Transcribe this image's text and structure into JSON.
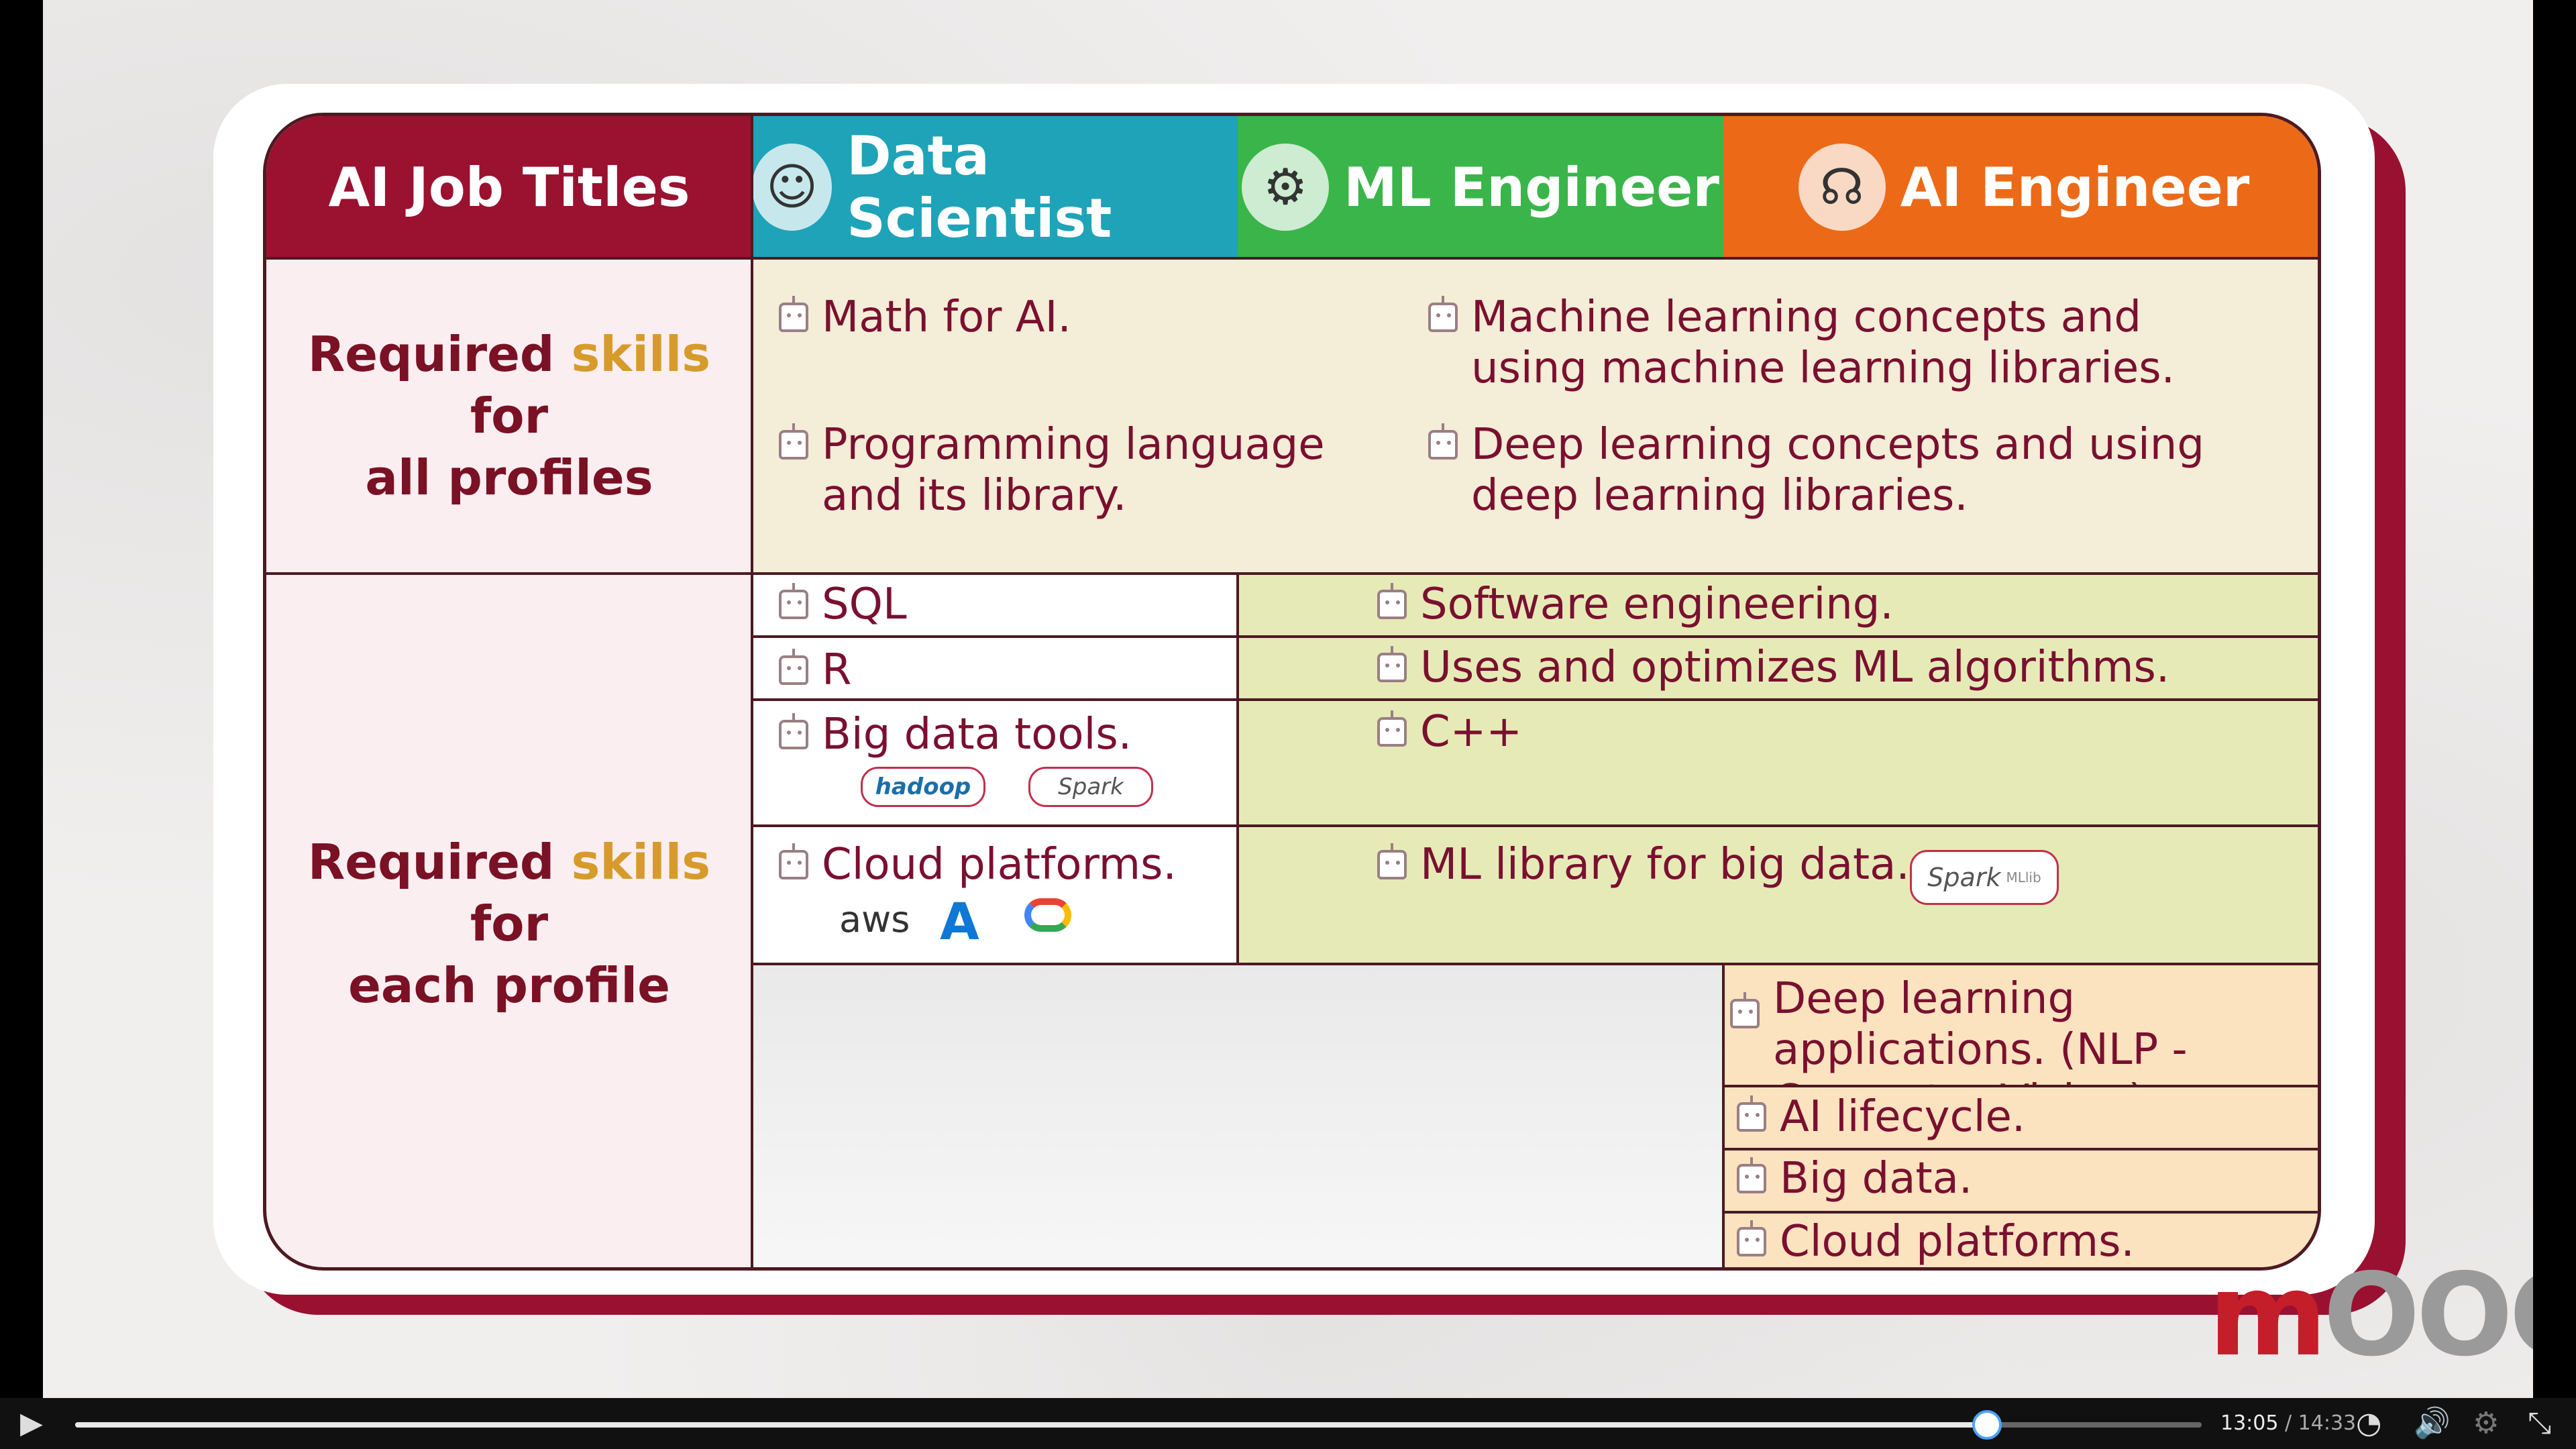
{
  "slide": {
    "header": {
      "titles_label": "AI Job Titles",
      "col1": "Data Scientist",
      "col2": "ML Engineer",
      "col3": "AI Engineer",
      "colors": {
        "titles": "#9b1130",
        "col1": "#1fa3b8",
        "col2": "#3ab54a",
        "col3": "#ec6a17"
      }
    },
    "row_all": {
      "label_a": "Required ",
      "label_gold": "skills",
      "label_b": " for",
      "label_c": "all profiles",
      "items": [
        "Math for AI.",
        "Programming language and its library.",
        "Machine learning concepts and using machine learning libraries.",
        "Deep learning concepts and using deep learning libraries."
      ]
    },
    "row_each": {
      "label_a": "Required ",
      "label_gold": "skills",
      "label_b": " for",
      "label_c": "each profile",
      "data_scientist": [
        "SQL",
        "R",
        "Big data tools.",
        "Cloud platforms."
      ],
      "ml_engineer": [
        "Software engineering.",
        "Uses and optimizes ML algorithms.",
        "C++",
        "ML library for big data."
      ],
      "ai_engineer": [
        "Deep learning applications. (NLP - Computer Vision)",
        "AI lifecycle.",
        "Big data.",
        "Cloud platforms."
      ],
      "logos": {
        "hadoop": "hadoop",
        "spark": "Spark",
        "aws": "aws",
        "azure": "A",
        "spark_mllib": "Spark",
        "mllib": "MLlib"
      }
    },
    "watermark": {
      "m": "m",
      "rest": "OOCA"
    }
  },
  "player": {
    "current_time": "13:05",
    "separator": " / ",
    "duration": "14:33",
    "progress": 0.899
  }
}
